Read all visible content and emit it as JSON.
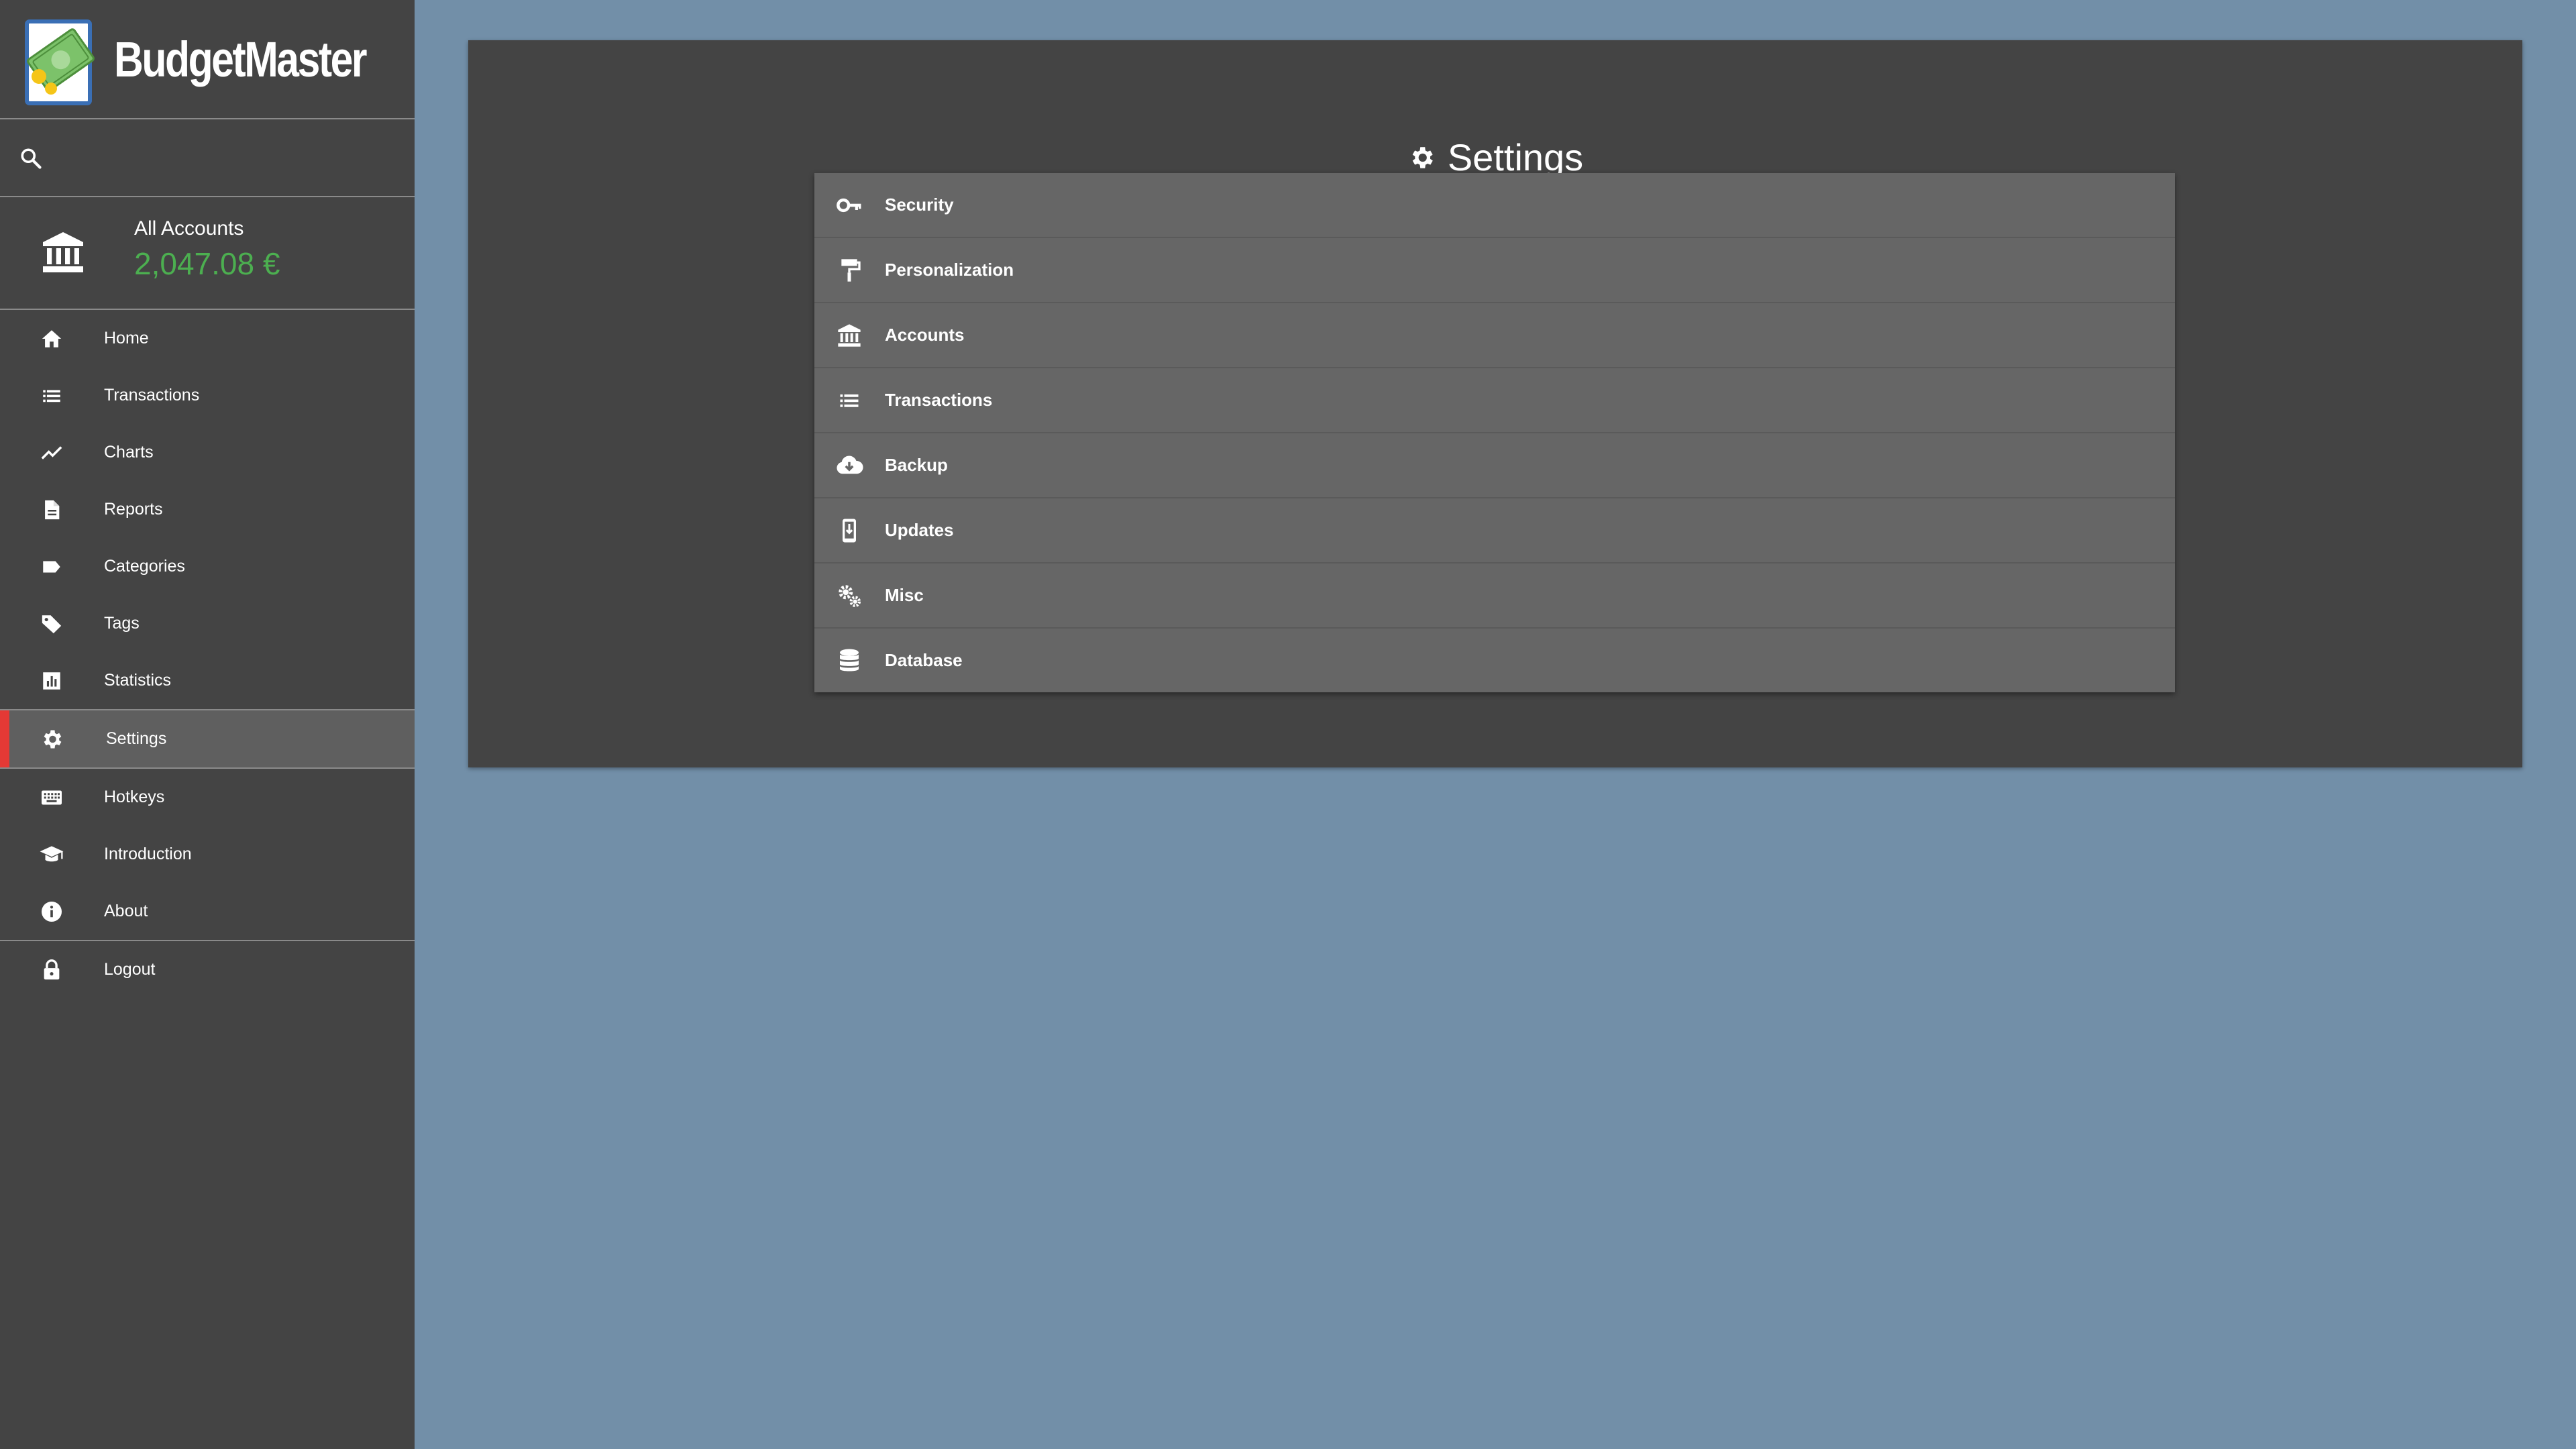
{
  "app": {
    "name": "BudgetMaster"
  },
  "search": {
    "placeholder": ""
  },
  "accounts": {
    "name": "All Accounts",
    "balance": "2,047.08 €",
    "balance_color": "#4CAF50"
  },
  "sidebar": {
    "items": [
      {
        "label": "Home",
        "icon": "home-icon"
      },
      {
        "label": "Transactions",
        "icon": "list-icon"
      },
      {
        "label": "Charts",
        "icon": "chart-line-icon"
      },
      {
        "label": "Reports",
        "icon": "document-icon"
      },
      {
        "label": "Categories",
        "icon": "label-icon"
      },
      {
        "label": "Tags",
        "icon": "tag-icon"
      },
      {
        "label": "Statistics",
        "icon": "bar-chart-icon"
      },
      {
        "label": "Settings",
        "icon": "gear-icon",
        "active": true
      },
      {
        "label": "Hotkeys",
        "icon": "keyboard-icon"
      },
      {
        "label": "Introduction",
        "icon": "graduation-cap-icon"
      },
      {
        "label": "About",
        "icon": "info-icon"
      },
      {
        "label": "Logout",
        "icon": "lock-icon"
      }
    ],
    "active_indicator_color": "#E53935"
  },
  "main": {
    "title": "Settings",
    "settings_items": [
      {
        "label": "Security",
        "icon": "key-icon"
      },
      {
        "label": "Personalization",
        "icon": "paint-roller-icon"
      },
      {
        "label": "Accounts",
        "icon": "bank-icon"
      },
      {
        "label": "Transactions",
        "icon": "list-icon"
      },
      {
        "label": "Backup",
        "icon": "cloud-download-icon"
      },
      {
        "label": "Updates",
        "icon": "system-update-icon"
      },
      {
        "label": "Misc",
        "icon": "gears-icon"
      },
      {
        "label": "Database",
        "icon": "database-icon"
      }
    ]
  },
  "colors": {
    "background": "#728FA8",
    "panel": "#444444",
    "list": "#666666"
  }
}
